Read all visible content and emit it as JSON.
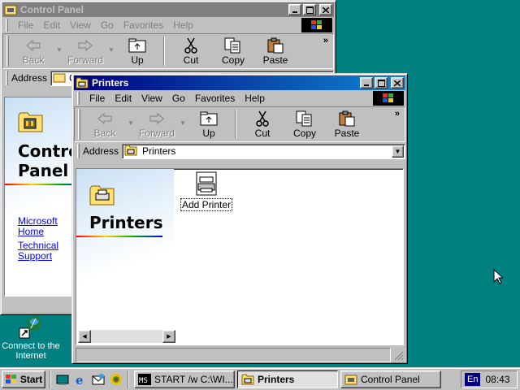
{
  "colors": {
    "desktop": "#008080",
    "titlebar_active": "#000080",
    "titlebar_inactive": "#808080",
    "link": "#0000ff"
  },
  "desktop_icons": [
    {
      "label": "Connect to the Internet",
      "icon": "connect-internet-icon"
    }
  ],
  "control_panel_window": {
    "title": "Control Panel",
    "menus": [
      "File",
      "Edit",
      "View",
      "Go",
      "Favorites",
      "Help"
    ],
    "toolbar": {
      "back": "Back",
      "forward": "Forward",
      "up": "Up",
      "cut": "Cut",
      "copy": "Copy",
      "paste": "Paste"
    },
    "address_label": "Address",
    "address_value": "C",
    "heading_line1": "Control",
    "heading_line2": "Panel",
    "links": [
      "Microsoft Home",
      "Technical Support"
    ]
  },
  "printers_window": {
    "title": "Printers",
    "menus": [
      "File",
      "Edit",
      "View",
      "Go",
      "Favorites",
      "Help"
    ],
    "toolbar": {
      "back": "Back",
      "forward": "Forward",
      "up": "Up",
      "cut": "Cut",
      "copy": "Copy",
      "paste": "Paste"
    },
    "address_label": "Address",
    "address_value": "Printers",
    "heading": "Printers",
    "items": [
      {
        "label": "Add Printer",
        "icon": "add-printer-icon"
      }
    ]
  },
  "taskbar": {
    "start_label": "Start",
    "quicklaunch": [
      "show-desktop-icon",
      "internet-explorer-icon",
      "outlook-express-icon",
      "channels-icon"
    ],
    "tasks": [
      {
        "label": "START /w C:\\WI...",
        "active": false
      },
      {
        "label": "Printers",
        "active": true
      },
      {
        "label": "Control Panel",
        "active": false
      }
    ],
    "language": "En",
    "clock": "08:43"
  }
}
